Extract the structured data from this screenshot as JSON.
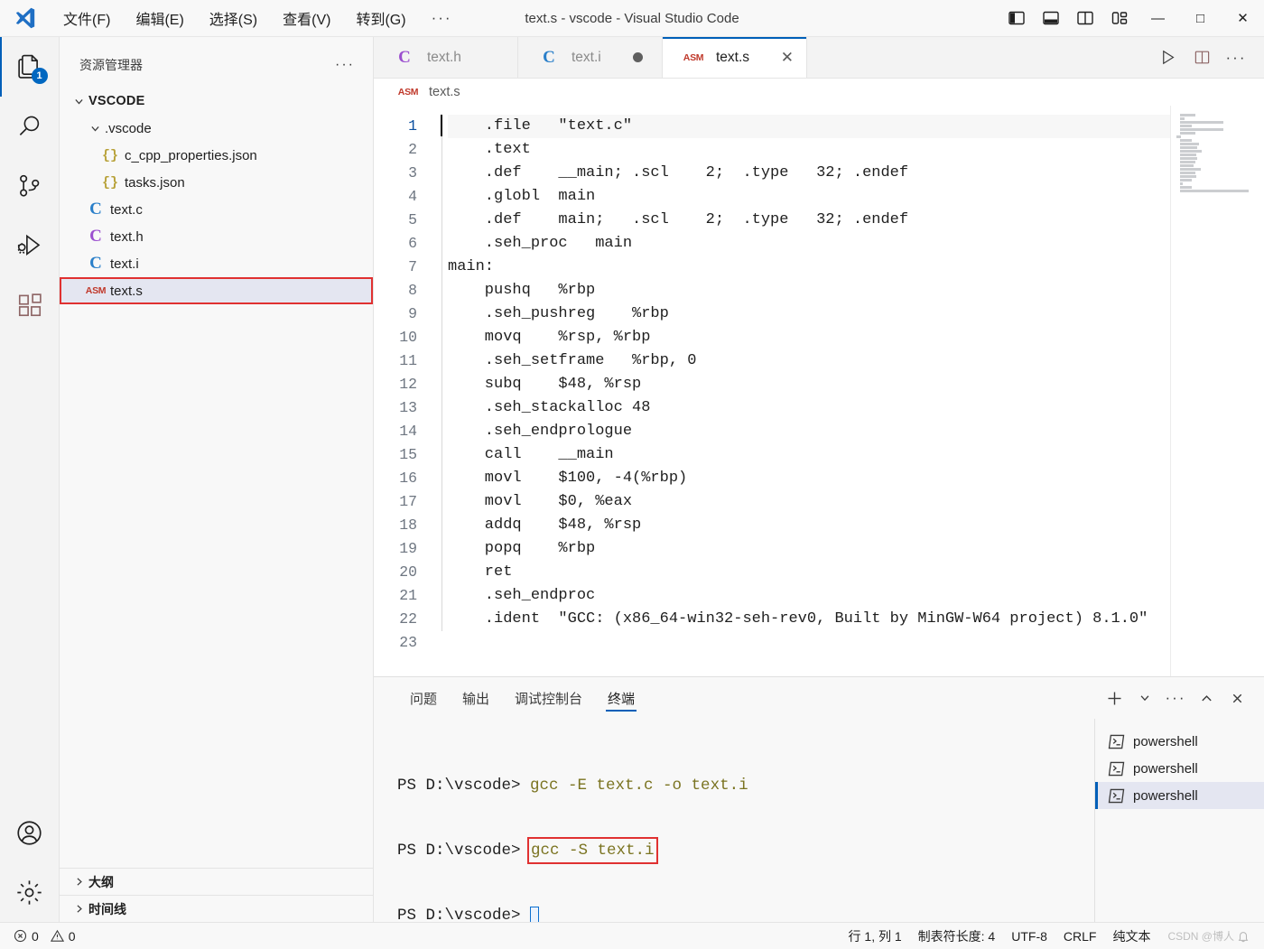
{
  "window": {
    "title": "text.s - vscode - Visual Studio Code",
    "menus": [
      "文件(F)",
      "编辑(E)",
      "选择(S)",
      "查看(V)",
      "转到(G)"
    ],
    "menu_overflow": "···",
    "layout_buttons": [
      "toggle-primary-sidebar",
      "toggle-panel",
      "toggle-secondary-sidebar",
      "customize-layout"
    ],
    "controls": {
      "minimize": "—",
      "maximize": "□",
      "close": "✕"
    }
  },
  "activitybar": {
    "items": [
      {
        "name": "explorer",
        "badge": "1",
        "active": true
      },
      {
        "name": "search",
        "badge": "",
        "active": false
      },
      {
        "name": "source-control",
        "badge": "",
        "active": false
      },
      {
        "name": "run-and-debug",
        "badge": "",
        "active": false
      },
      {
        "name": "extensions",
        "badge": "",
        "active": false
      }
    ],
    "bottom": [
      {
        "name": "accounts"
      },
      {
        "name": "manage-settings"
      }
    ]
  },
  "sidebar": {
    "title": "资源管理器",
    "more": "···",
    "tree": [
      {
        "label": "VSCODE",
        "icon": "chevron-down",
        "kind": "folder-root",
        "depth": 0,
        "selected": false,
        "boxed": false
      },
      {
        "label": ".vscode",
        "icon": "chevron-down",
        "kind": "folder",
        "depth": 1,
        "selected": false,
        "boxed": false
      },
      {
        "label": "c_cpp_properties.json",
        "icon": "{}",
        "kind": "json",
        "depth": 2,
        "selected": false,
        "boxed": false
      },
      {
        "label": "tasks.json",
        "icon": "{}",
        "kind": "json",
        "depth": 2,
        "selected": false,
        "boxed": false
      },
      {
        "label": "text.c",
        "icon": "C",
        "kind": "c-blue",
        "depth": 1,
        "selected": false,
        "boxed": false
      },
      {
        "label": "text.h",
        "icon": "C",
        "kind": "c-purple",
        "depth": 1,
        "selected": false,
        "boxed": false
      },
      {
        "label": "text.i",
        "icon": "C",
        "kind": "c-blue",
        "depth": 1,
        "selected": false,
        "boxed": false
      },
      {
        "label": "text.s",
        "icon": "ASM",
        "kind": "asm",
        "depth": 1,
        "selected": true,
        "boxed": true
      }
    ],
    "sections": [
      {
        "label": "大纲",
        "expanded": false
      },
      {
        "label": "时间线",
        "expanded": false
      }
    ]
  },
  "editor": {
    "tabs": [
      {
        "label": "text.h",
        "icon": "C",
        "kind": "c-purple",
        "active": false,
        "dirty": false,
        "closable": false
      },
      {
        "label": "text.i",
        "icon": "C",
        "kind": "c-blue",
        "active": false,
        "dirty": true,
        "closable": false
      },
      {
        "label": "text.s",
        "icon": "ASM",
        "kind": "asm",
        "active": true,
        "dirty": false,
        "closable": true
      }
    ],
    "tab_actions": [
      "run-code-button",
      "split-editor-button",
      "more-actions-button"
    ],
    "breadcrumb": {
      "icon": "ASM",
      "label": "text.s"
    },
    "line_count": 23,
    "lines": [
      "    .file   \"text.c\"",
      "    .text",
      "    .def    __main; .scl    2;  .type   32; .endef",
      "    .globl  main",
      "    .def    main;   .scl    2;  .type   32; .endef",
      "    .seh_proc   main",
      "main:",
      "    pushq   %rbp",
      "    .seh_pushreg    %rbp",
      "    movq    %rsp, %rbp",
      "    .seh_setframe   %rbp, 0",
      "    subq    $48, %rsp",
      "    .seh_stackalloc 48",
      "    .seh_endprologue",
      "    call    __main",
      "    movl    $100, -4(%rbp)",
      "    movl    $0, %eax",
      "    addq    $48, %rsp",
      "    popq    %rbp",
      "    ret",
      "    .seh_endproc",
      "    .ident  \"GCC: (x86_64-win32-seh-rev0, Built by MinGW-W64 project) 8.1.0\"",
      ""
    ]
  },
  "panel": {
    "tabs": [
      {
        "label": "问题",
        "active": false
      },
      {
        "label": "输出",
        "active": false
      },
      {
        "label": "调试控制台",
        "active": false
      },
      {
        "label": "终端",
        "active": true
      }
    ],
    "actions": [
      "new-terminal-icon",
      "chevron-down-icon",
      "more-actions-icon",
      "chevron-up-icon",
      "close-icon"
    ],
    "terminal": {
      "lines": [
        {
          "prompt": "PS D:\\vscode> ",
          "command": "gcc -E text.c -o text.i",
          "boxed": false,
          "cursor": false
        },
        {
          "prompt": "PS D:\\vscode> ",
          "command": "gcc -S text.i",
          "boxed": true,
          "cursor": false
        },
        {
          "prompt": "PS D:\\vscode> ",
          "command": "",
          "boxed": false,
          "cursor": true
        }
      ]
    },
    "shells": [
      {
        "label": "powershell",
        "active": false
      },
      {
        "label": "powershell",
        "active": false
      },
      {
        "label": "powershell",
        "active": true
      }
    ]
  },
  "statusbar": {
    "errors": "0",
    "warnings": "0",
    "right_items": [
      "行 1, 列 1",
      "制表符长度: 4",
      "UTF-8",
      "CRLF",
      "纯文本"
    ],
    "watermark": "CSDN @博人"
  },
  "colors": {
    "accent": "#005fb8",
    "badge": "#0067c0",
    "highlight_box": "#e03131",
    "selection": "#e4e6f1",
    "titlebar_bg": "#f8f8f8",
    "editor_bg": "#ffffff"
  }
}
